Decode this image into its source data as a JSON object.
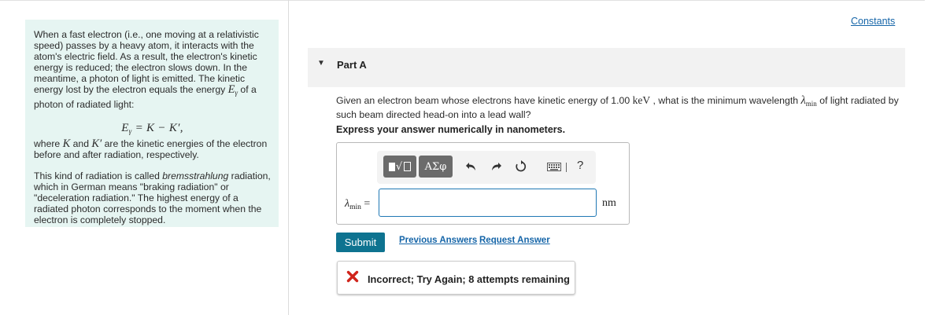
{
  "intro": {
    "p1_a": "When a fast electron (i.e., one moving at a relativistic speed) passes by a heavy atom, it interacts with the atom's electric field. As a result, the electron's kinetic energy is reduced; the electron slows down. In the meantime, a photon of light is emitted. The kinetic energy lost by the electron equals the energy ",
    "p1_sym": "E",
    "p1_sub": "γ",
    "p1_b": " of a photon of radiated light:",
    "equation": "E",
    "equation_sub": "γ",
    "equation_rest": " = K − K′,",
    "p2_a": "where ",
    "p2_k": "K",
    "p2_and": " and ",
    "p2_kp": "K′",
    "p2_b": " are the kinetic energies of the electron before and after radiation, respectively.",
    "p3_a": "This kind of radiation is called ",
    "p3_em": "bremsstrahlung",
    "p3_b": " radiation, which in German means \"braking radiation\" or \"deceleration radiation.\" The highest energy of a radiated photon corresponds to the moment when the electron is completely stopped."
  },
  "header": {
    "constants_link": "Constants"
  },
  "part": {
    "title": "Part A",
    "question_a": "Given an electron beam whose electrons have kinetic energy of 1.00 ",
    "question_unit": "keV",
    "question_b": " , what is the minimum wavelength ",
    "question_sym": "λ",
    "question_sub": "min",
    "question_c": " of light radiated by such beam directed head-on into a lead wall?",
    "instruction": "Express your answer numerically in nanometers."
  },
  "answer": {
    "toolbar": {
      "templates_icon": "template-icon",
      "greek_label": "ΑΣφ",
      "help_label": "?"
    },
    "label_sym": "λ",
    "label_sub": "min",
    "label_eq": " =",
    "value": "",
    "unit": "nm"
  },
  "actions": {
    "submit_label": "Submit",
    "previous_answers": "Previous Answers",
    "request_answer": "Request Answer"
  },
  "feedback": {
    "icon": "x-icon",
    "icon_color": "#d0241b",
    "message": "Incorrect; Try Again; 8 attempts remaining"
  }
}
